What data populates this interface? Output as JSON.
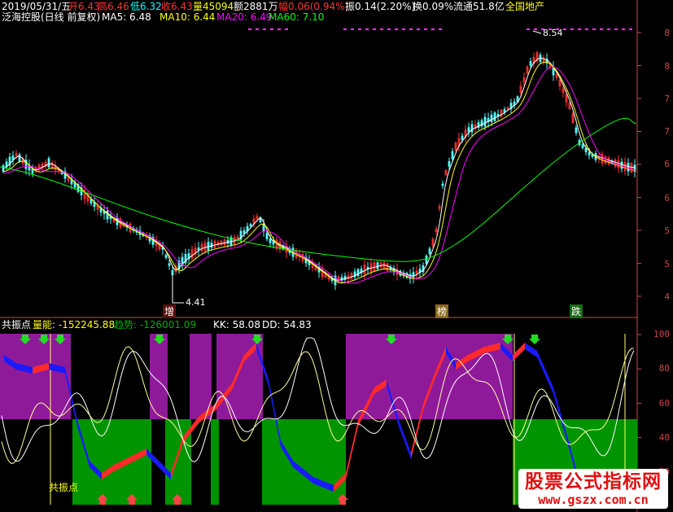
{
  "main_panel": {
    "stock_name": "泛海控股(日线 前复权)",
    "ma5_label": "MA5: 6.48",
    "ma10_label": "MA10: 6.44",
    "ma20_label": "MA20: 6.49",
    "ma60_label": "MA60: 7.10",
    "date_label": "2019/05/31/五",
    "open_label": "开6.43",
    "high_label": "高6.46",
    "low_label": "低6.32",
    "close_label": "收6.43",
    "volume_label": "量45094",
    "amount_label": "额2881万",
    "change_label": "幅0.06(0.94%)",
    "amplitude_label": "振0.14(2.20%)",
    "turnover_label": "换0.09%",
    "float_label": "流通51.8亿",
    "sector_label": "全国地产",
    "max_price_label": "8.54",
    "min_price_label": "4.41",
    "event_tags": [
      "增",
      "榜",
      "跌"
    ],
    "price_axis": [
      "8",
      "8",
      "7",
      "7",
      "6",
      "6",
      "5",
      "5",
      "4"
    ]
  },
  "indicator_panel": {
    "name": "共振点",
    "energy_label": "量能: -152245.88",
    "trend_label": "趋势: -126001.09",
    "kk_label": "KK: 58.08",
    "dd_label": "DD: 54.83",
    "signal_label": "共振点",
    "axis": [
      "100",
      "80",
      "60",
      "40",
      "20"
    ]
  },
  "watermark": {
    "line1": "股票公式指标网",
    "line2": "www.gszx.com.cn"
  },
  "colors": {
    "background": "#000000",
    "up": "#ff3232",
    "down": "#54ffff",
    "ma5": "#ffffff",
    "ma10": "#ffff00",
    "ma20": "#ff00ff",
    "ma60": "#00ff00",
    "purple_zone": "#8e1a9a",
    "green_zone": "#009400",
    "ribbon_up": "#ff2a2a",
    "ribbon_down": "#1a1aff",
    "axis": "#c84a4a"
  }
}
